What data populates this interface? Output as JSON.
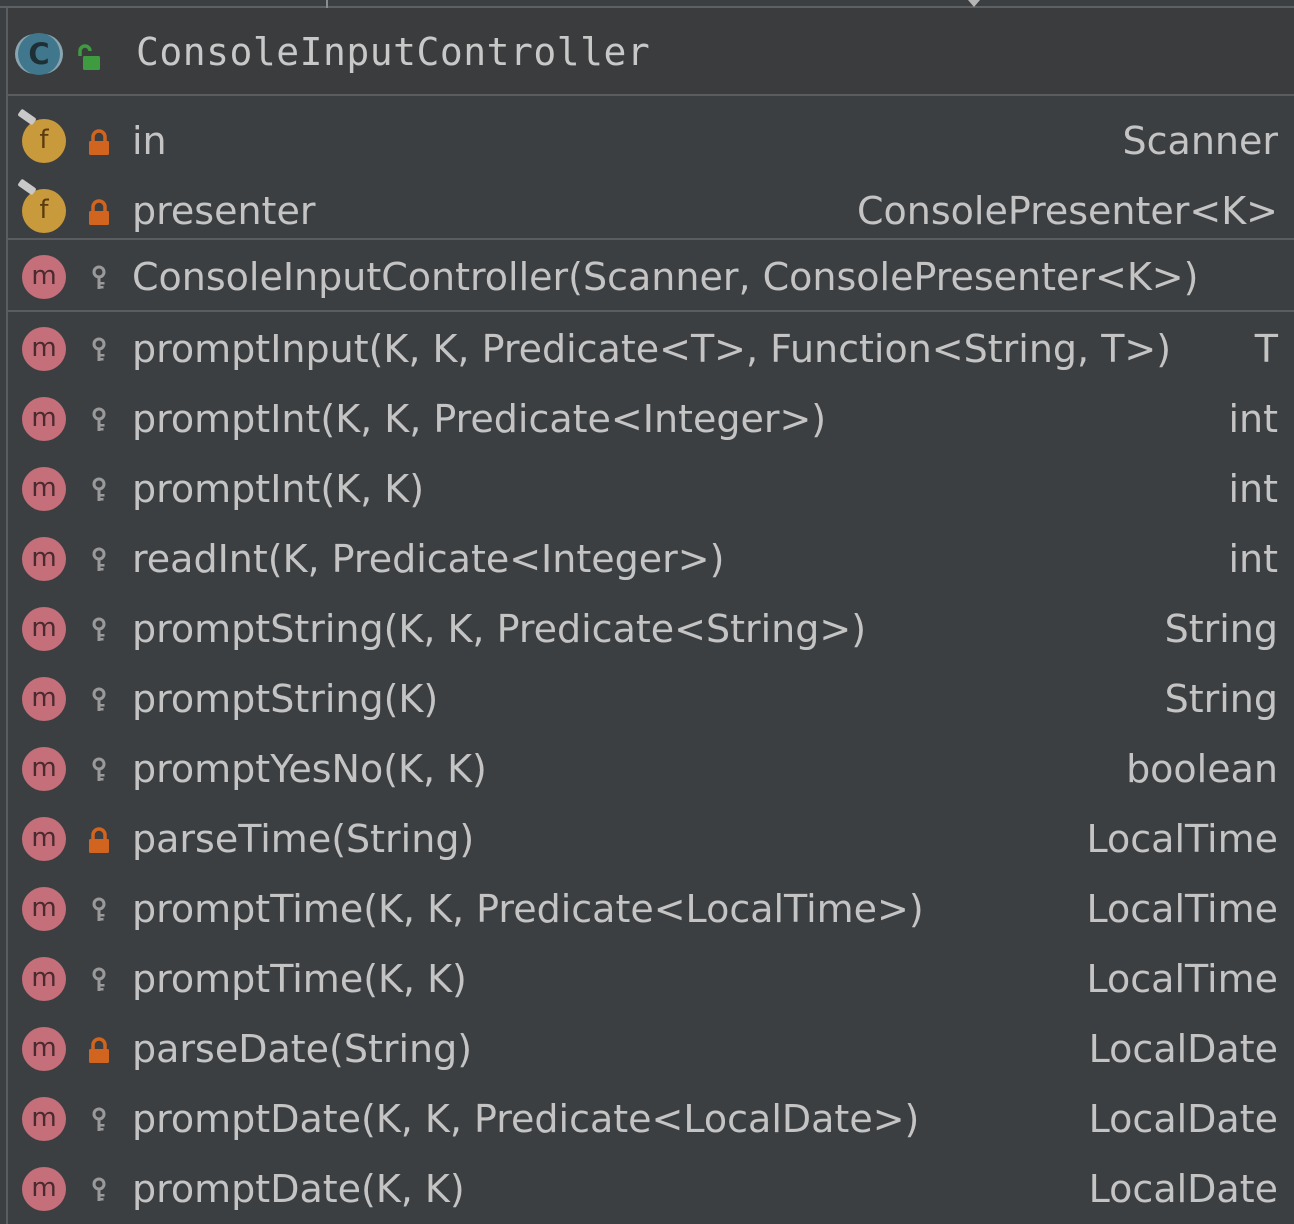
{
  "class_name": "ConsoleInputController",
  "icons": {
    "class": "C",
    "method": "m",
    "field": "f"
  },
  "colors": {
    "class_icon": "#40778d",
    "method_icon": "#c46f79",
    "field_icon": "#c99a3b",
    "private_lock": "#d1651f",
    "package_key": "#9a9a9a",
    "public_unlock": "#3f9b3f"
  },
  "fields": [
    {
      "name": "in",
      "type": "Scanner",
      "visibility": "private"
    },
    {
      "name": "presenter",
      "type": "ConsolePresenter<K>",
      "visibility": "private"
    }
  ],
  "constructors": [
    {
      "name": "ConsoleInputController(Scanner, ConsolePresenter<K>)",
      "type": "",
      "visibility": "package"
    }
  ],
  "methods": [
    {
      "name": "promptInput(K, K, Predicate<T>, Function<String, T>)",
      "type": "T",
      "visibility": "package"
    },
    {
      "name": "promptInt(K, K, Predicate<Integer>)",
      "type": "int",
      "visibility": "package"
    },
    {
      "name": "promptInt(K, K)",
      "type": "int",
      "visibility": "package"
    },
    {
      "name": "readInt(K, Predicate<Integer>)",
      "type": "int",
      "visibility": "package"
    },
    {
      "name": "promptString(K, K, Predicate<String>)",
      "type": "String",
      "visibility": "package"
    },
    {
      "name": "promptString(K)",
      "type": "String",
      "visibility": "package"
    },
    {
      "name": "promptYesNo(K, K)",
      "type": "boolean",
      "visibility": "package"
    },
    {
      "name": "parseTime(String)",
      "type": "LocalTime",
      "visibility": "private"
    },
    {
      "name": "promptTime(K, K, Predicate<LocalTime>)",
      "type": "LocalTime",
      "visibility": "package"
    },
    {
      "name": "promptTime(K, K)",
      "type": "LocalTime",
      "visibility": "package"
    },
    {
      "name": "parseDate(String)",
      "type": "LocalDate",
      "visibility": "private"
    },
    {
      "name": "promptDate(K, K, Predicate<LocalDate>)",
      "type": "LocalDate",
      "visibility": "package"
    },
    {
      "name": "promptDate(K, K)",
      "type": "LocalDate",
      "visibility": "package"
    }
  ]
}
